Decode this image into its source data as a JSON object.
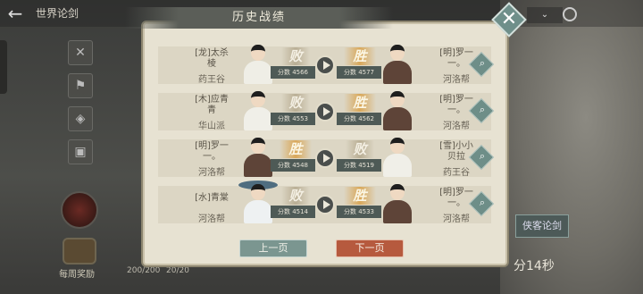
{
  "background": {
    "world_title": "世界论剑",
    "weekly_reward_label": "每周奖励",
    "counter_left": "200/200",
    "counter_right": "20/20",
    "xiake_button": "侠客论剑",
    "timer_text": "分14秒"
  },
  "modal": {
    "title": "历史战绩",
    "rows": [
      {
        "left_name": "[龙]太杀\n棱",
        "left_sect": "药王谷",
        "left_score": "分数 4566",
        "left_result": "败",
        "right_name": "[明]罗一\n一。",
        "right_sect": "河洛帮",
        "right_score": "分数 4577",
        "right_result": "胜"
      },
      {
        "left_name": "[木]应青\n青",
        "left_sect": "华山派",
        "left_score": "分数 4553",
        "left_result": "败",
        "right_name": "[明]罗一\n一。",
        "right_sect": "河洛帮",
        "right_score": "分数 4562",
        "right_result": "胜"
      },
      {
        "left_name": "[明]罗一\n一。",
        "left_sect": "河洛帮",
        "left_score": "分数 4548",
        "left_result": "胜",
        "right_name": "[雪]小小\n贝拉",
        "right_sect": "药王谷",
        "right_score": "分数 4519",
        "right_result": "败"
      },
      {
        "left_name": "[水]青棠",
        "left_sect": "河洛帮",
        "left_score": "分数 4514",
        "left_result": "败",
        "right_name": "[明]罗一\n一。",
        "right_sect": "河洛帮",
        "right_score": "分数 4533",
        "right_result": "胜"
      }
    ],
    "prev_button": "上一页",
    "next_button": "下一页"
  },
  "colors": {
    "modal_bg": "#e7e2d2",
    "row_bg": "#dcd6c4",
    "win_gold": "#d9a85a",
    "lose_gray": "#b9ae94",
    "teal_button": "#7b9690",
    "next_button_red": "#b65a3e"
  },
  "icons": {
    "close": "close-icon",
    "play": "play-icon",
    "search": "search-icon",
    "back": "back-arrow-icon"
  }
}
